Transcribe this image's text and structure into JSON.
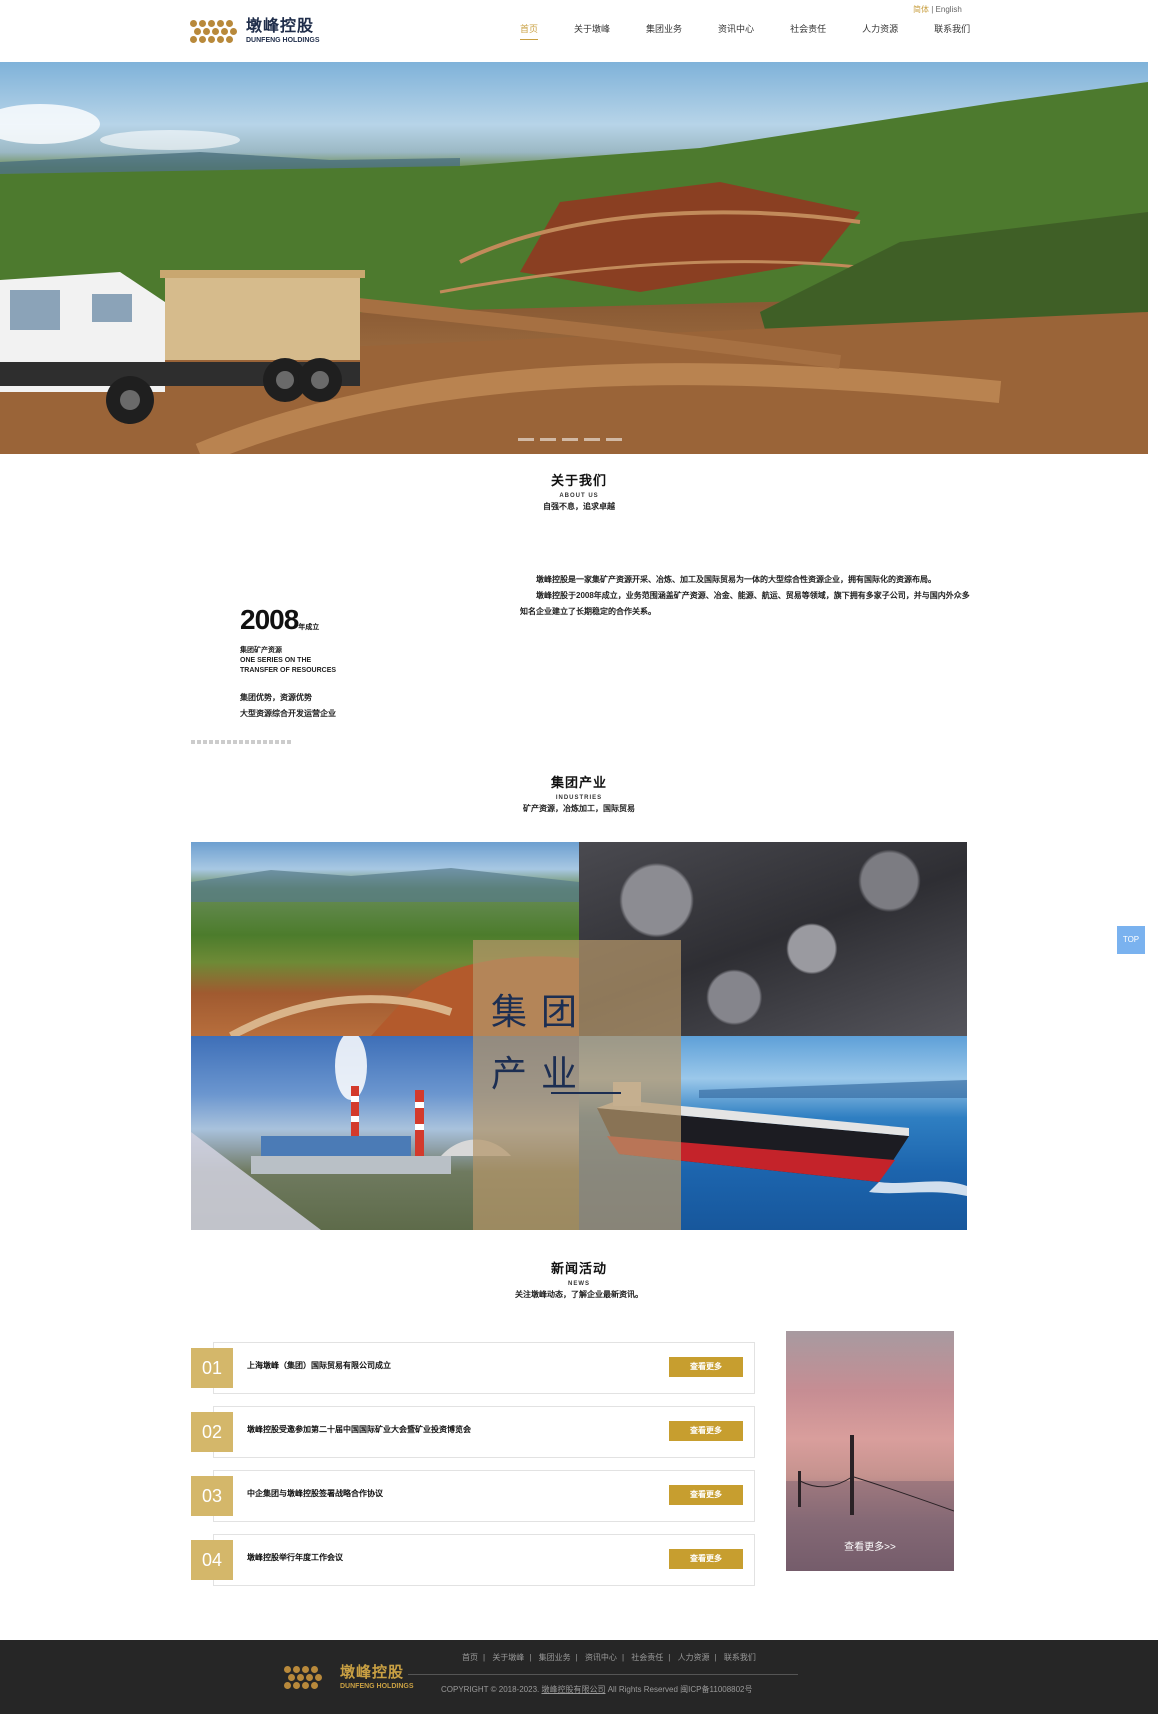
{
  "header": {
    "logo_cn": "墩峰控股",
    "logo_en": "DUNFENG HOLDINGS",
    "lang_cn": "简体",
    "lang_sep": "|",
    "lang_en": "English",
    "nav": [
      "首页",
      "关于墩峰",
      "集团业务",
      "资讯中心",
      "社会责任",
      "人力资源",
      "联系我们"
    ]
  },
  "about": {
    "title": "关于我们",
    "subtitle": "ABOUT US",
    "tagline": "自强不息，追求卓越",
    "year": "2008",
    "year_unit": "年成立",
    "left_lines": [
      "集团矿产资源",
      "ONE SERIES ON THE",
      "TRANSFER OF RESOURCES"
    ],
    "left_lines2": [
      "集团优势，资源优势",
      "大型资源综合开发运营企业"
    ],
    "para1": "墩峰控股是一家集矿产资源开采、冶炼、加工及国际贸易为一体的大型综合性资源企业，拥有国际化的资源布局。",
    "para2": "墩峰控股于2008年成立，业务范围涵盖矿产资源、冶金、能源、航运、贸易等领域，旗下拥有多家子公司，并与国内外众多知名企业建立了长期稳定的合作关系。"
  },
  "industry": {
    "title": "集团产业",
    "subtitle": "INDUSTRIES",
    "tagline": "矿产资源，冶炼加工，国际贸易",
    "overlay_line1": "集团",
    "overlay_line2": "产业"
  },
  "top_button": "TOP",
  "news": {
    "title": "新闻活动",
    "subtitle": "NEWS",
    "tagline": "关注墩峰动态，了解企业最新资讯。",
    "items": [
      {
        "num": "01",
        "title": "上海墩峰（集团）国际贸易有限公司成立",
        "more": "查看更多"
      },
      {
        "num": "02",
        "title": "墩峰控股受邀参加第二十届中国国际矿业大会暨矿业投资博览会",
        "more": "查看更多"
      },
      {
        "num": "03",
        "title": "中企集团与墩峰控股签署战略合作协议",
        "more": "查看更多"
      },
      {
        "num": "04",
        "title": "墩峰控股举行年度工作会议",
        "more": "查看更多"
      }
    ],
    "side_more": "查看更多>>"
  },
  "footer": {
    "logo_cn": "墩峰控股",
    "logo_en": "DUNFENG HOLDINGS",
    "links": [
      "首页",
      "关于墩峰",
      "集团业务",
      "资讯中心",
      "社会责任",
      "人力资源",
      "联系我们"
    ],
    "copy_prefix": "COPYRIGHT © 2018-2023.",
    "copy_company": "墩峰控股有限公司",
    "copy_suffix": "All Rights Reserved    闽ICP备11008802号"
  }
}
